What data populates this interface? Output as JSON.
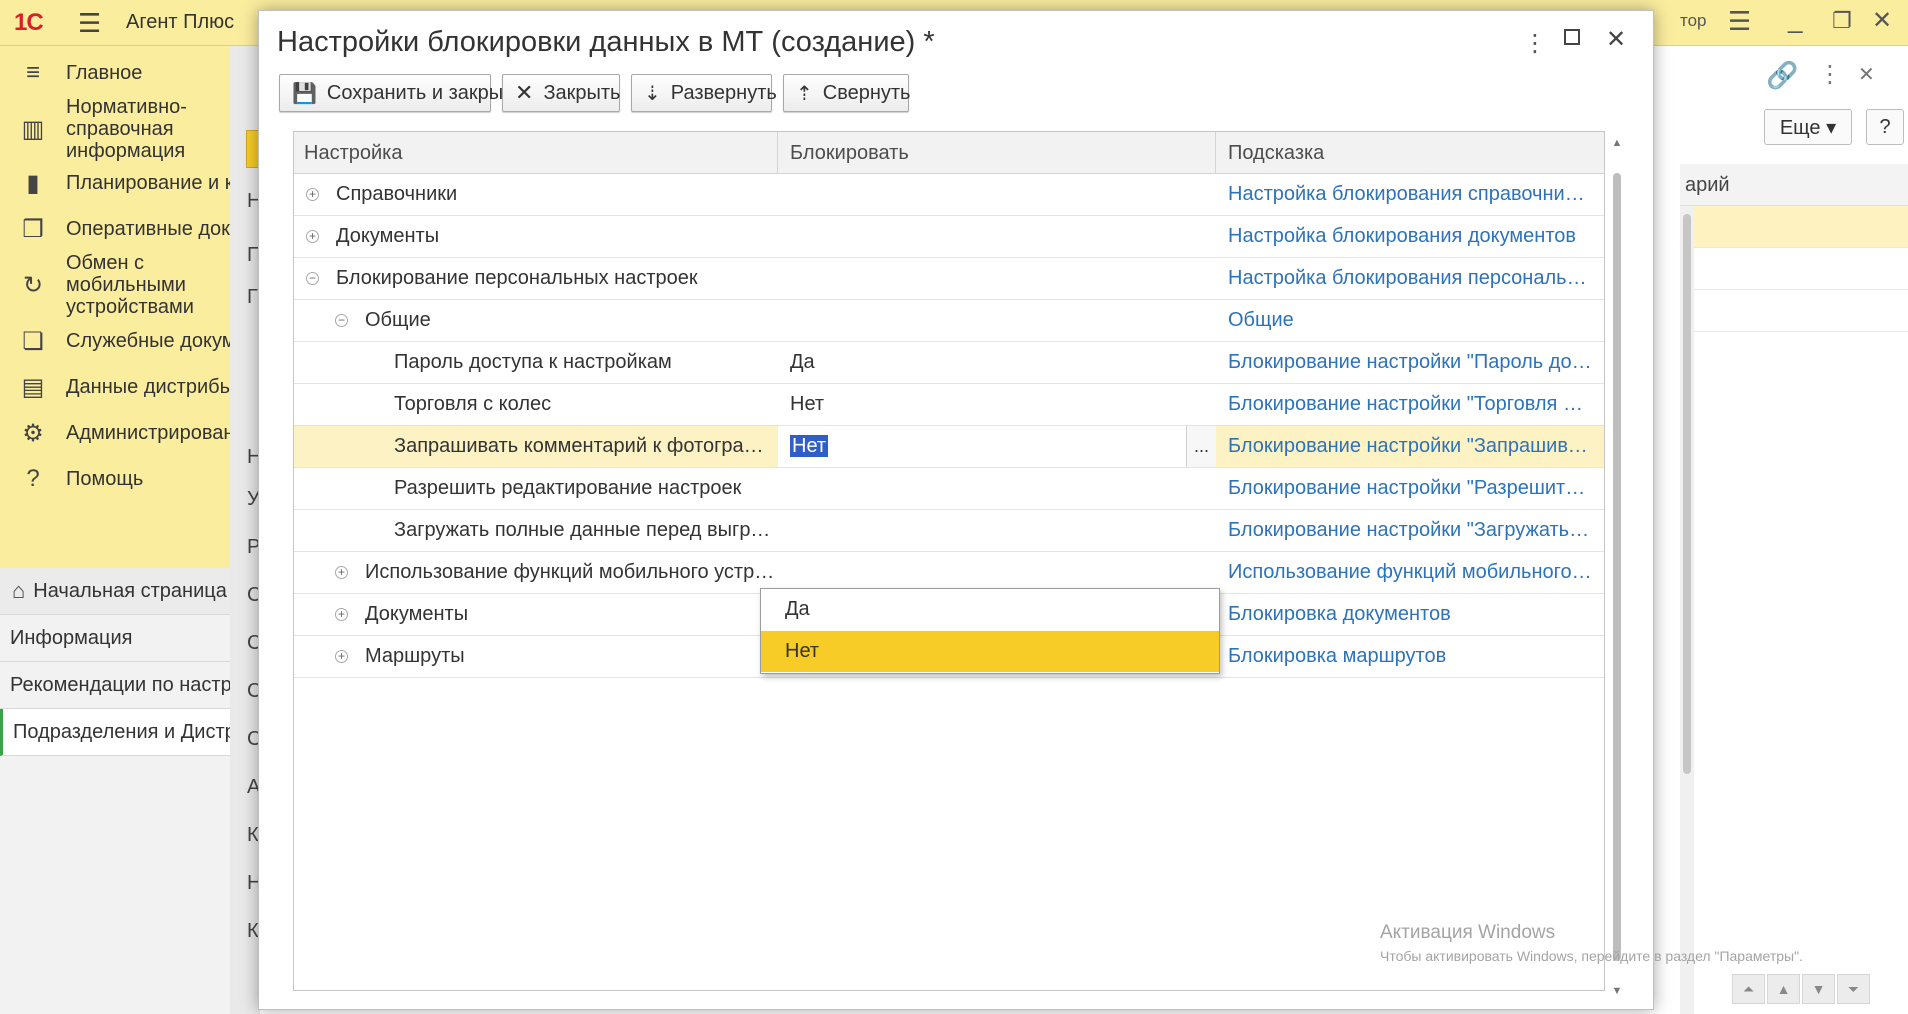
{
  "app": {
    "logo": "1С",
    "title": "Агент Плюс",
    "user_fragment": "тор"
  },
  "sidebar": {
    "items": [
      {
        "icon": "menu-icon",
        "label": "Главное"
      },
      {
        "icon": "book-icon",
        "label": "Нормативно-справочная информация"
      },
      {
        "icon": "chart-icon",
        "label": "Планирование и контроль"
      },
      {
        "icon": "docs-icon",
        "label": "Оперативные документы"
      },
      {
        "icon": "sync-icon",
        "label": "Обмен с мобильными устройствами"
      },
      {
        "icon": "doc-icon",
        "label": "Служебные документы"
      },
      {
        "icon": "data-icon",
        "label": "Данные дистрибьюторов"
      },
      {
        "icon": "gear-icon",
        "label": "Администрирование"
      },
      {
        "icon": "question-icon",
        "label": "Помощь"
      }
    ]
  },
  "open_tabs": [
    {
      "label": "Начальная страница"
    },
    {
      "label": "Информация"
    },
    {
      "label": "Рекомендации по настройке"
    },
    {
      "label": "Подразделения и Дистрибьюторы"
    }
  ],
  "background_letters": [
    "Н",
    "П",
    "Г",
    "Н",
    "У",
    "Р",
    "С",
    "С",
    "С",
    "С",
    "А",
    "К",
    "Н",
    "К"
  ],
  "right_panel": {
    "more_label": "Еще ▾",
    "help_label": "?",
    "column_fragment": "арий"
  },
  "modal": {
    "title": "Настройки блокировки данных в МТ (создание) *",
    "toolbar": {
      "save_close": "Сохранить и закрыть",
      "close": "Закрыть",
      "expand": "Развернуть",
      "collapse": "Свернуть"
    },
    "columns": {
      "setting": "Настройка",
      "block": "Блокировать",
      "hint": "Подсказка"
    },
    "rows": [
      {
        "name": "Справочники",
        "value": "",
        "hint": "Настройка блокирования справочников"
      },
      {
        "name": "Документы",
        "value": "",
        "hint": "Настройка блокирования документов"
      },
      {
        "name": "Блокирование персональных настроек",
        "value": "",
        "hint": "Настройка блокирования персональных настроек"
      },
      {
        "name": "Общие",
        "value": "",
        "hint": "Общие"
      },
      {
        "name": "Пароль доступа к настройкам",
        "value": "Да",
        "hint": "Блокирование настройки \"Пароль доступа к настройкам\""
      },
      {
        "name": "Торговля с колес",
        "value": "Нет",
        "hint": "Блокирование настройки \"Торговля с колес\""
      },
      {
        "name": "Запрашивать комментарий к фотографии",
        "value": "Нет",
        "hint": "Блокирование настройки \"Запрашивать комментарий к фотографии\""
      },
      {
        "name": "Разрешить редактирование настроек",
        "value": "",
        "hint": "Блокирование настройки \"Разрешить редактирование настроек\""
      },
      {
        "name": "Загружать полные данные перед выгрузкой",
        "value": "",
        "hint": "Блокирование настройки \"Загружать полные данные перед выгрузкой\""
      },
      {
        "name": "Использование функций мобильного устройства",
        "value": "",
        "hint": "Использование функций мобильного устройства"
      },
      {
        "name": "Документы",
        "value": "",
        "hint": "Блокировка документов"
      },
      {
        "name": "Маршруты",
        "value": "",
        "hint": "Блокировка маршрутов"
      }
    ],
    "select_button": "...",
    "dropdown_options": [
      "Да",
      "Нет"
    ]
  },
  "watermark": {
    "title": "Активация Windows",
    "subtitle": "Чтобы активировать Windows, перейдите в раздел \"Параметры\"."
  }
}
